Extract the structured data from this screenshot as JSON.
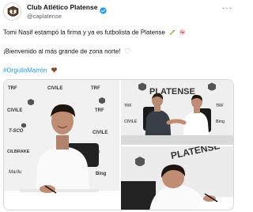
{
  "account": {
    "display_name": "Club Atlético Platense",
    "handle": "@caplatense"
  },
  "header": {
    "more_label": "···"
  },
  "tweet": {
    "line1": "Tomi Nasif estampó la firma y ya es futbolista de Platense",
    "line2": "¡Bienvenido al más grande de zona norte!",
    "hashtag": "#OrgulloMarrón"
  },
  "backdrop": {
    "sponsors": [
      "TRF",
      "CIVILE",
      "T-SCO",
      "CILBRAKE",
      "Marilu",
      "Bing"
    ],
    "brand": "PLATENSE"
  },
  "icons": {
    "verified": "verified-badge-icon",
    "more": "more-options-icon",
    "emoji_line1a": "pen-emoji-icon",
    "emoji_line1b": "signature-emoji-icon",
    "emoji_line2": "white-heart-emoji-icon",
    "emoji_hashtag": "brown-heart-emoji-icon"
  },
  "colors": {
    "hashtag": "#1d9bf0",
    "verified": "#1d9bf0",
    "brown_heart": "#8b4a2b"
  }
}
